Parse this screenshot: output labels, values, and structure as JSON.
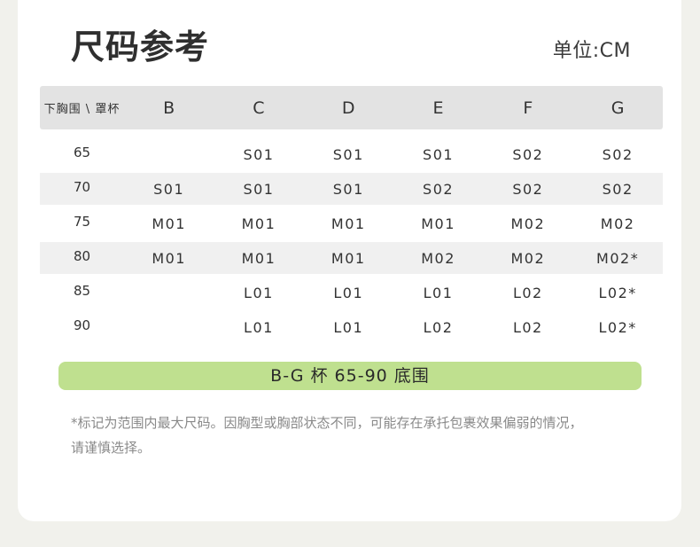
{
  "title": "尺码参考",
  "unit": "单位:CM",
  "table": {
    "corner": "下胸围 \\ 罩杯",
    "cups": [
      "B",
      "C",
      "D",
      "E",
      "F",
      "G"
    ],
    "rows": [
      {
        "band": "65",
        "cells": [
          "",
          "S01",
          "S01",
          "S01",
          "S02",
          "S02"
        ]
      },
      {
        "band": "70",
        "cells": [
          "S01",
          "S01",
          "S01",
          "S02",
          "S02",
          "S02"
        ]
      },
      {
        "band": "75",
        "cells": [
          "M01",
          "M01",
          "M01",
          "M01",
          "M02",
          "M02"
        ]
      },
      {
        "band": "80",
        "cells": [
          "M01",
          "M01",
          "M01",
          "M02",
          "M02",
          "M02*"
        ]
      },
      {
        "band": "85",
        "cells": [
          "",
          "L01",
          "L01",
          "L01",
          "L02",
          "L02*"
        ]
      },
      {
        "band": "90",
        "cells": [
          "",
          "L01",
          "L01",
          "L02",
          "L02",
          "L02*"
        ]
      }
    ]
  },
  "range_label": "B-G 杯  65-90 底围",
  "note_line1": "*标记为范围内最大尺码。因胸型或胸部状态不同，可能存在承托包裹效果偏弱的情况，",
  "note_line2": "请谨慎选择。"
}
